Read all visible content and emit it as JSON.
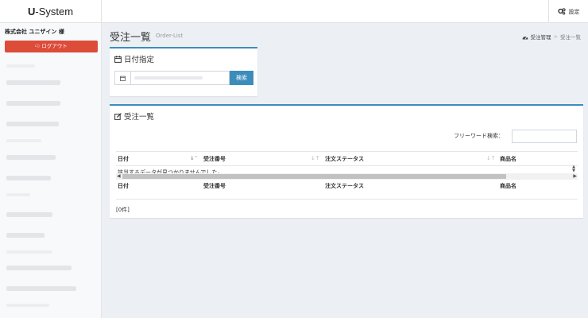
{
  "app": {
    "brand_bold": "U",
    "brand_rest": "-System",
    "settings_label": "設定"
  },
  "sidebar": {
    "company": "株式会社 ユニザイン 様",
    "logout_label": "ログアウト"
  },
  "page": {
    "title": "受注一覧",
    "subtitle": "Order-List"
  },
  "breadcrumb": {
    "home": "受注管理",
    "separator": ">",
    "current": "受注一覧"
  },
  "date_box": {
    "title": "日付指定",
    "search_label": "検索"
  },
  "orders_box": {
    "title": "受注一覧",
    "keyword_label": "フリーワード検索：",
    "keyword_value": "",
    "columns": [
      "日付",
      "受注番号",
      "注文ステータス",
      "商品名"
    ],
    "empty_message": "該当するデータが見つかりませんでした。",
    "count": "[0件]"
  },
  "colors": {
    "accent": "#3c8dbc",
    "danger": "#dd4b39",
    "background": "#ecf0f5"
  },
  "icons": [
    "gears-icon",
    "sign-out-icon",
    "dashboard-icon",
    "calendar-icon",
    "edit-icon"
  ]
}
